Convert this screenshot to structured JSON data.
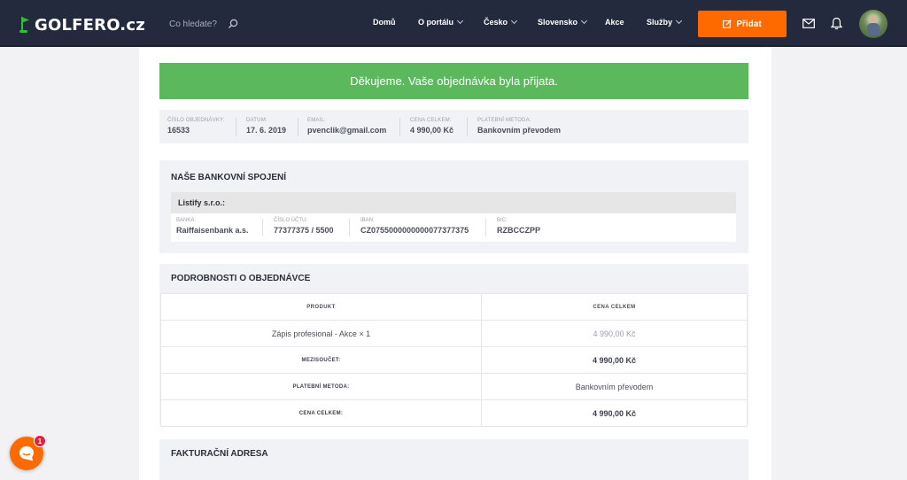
{
  "header": {
    "logo_text": "GOLFERO.cz",
    "search_placeholder": "Co hledate?",
    "nav": [
      {
        "label": "Domů",
        "has_dropdown": false
      },
      {
        "label": "O portálu",
        "has_dropdown": true
      },
      {
        "label": "Česko",
        "has_dropdown": true
      },
      {
        "label": "Slovensko",
        "has_dropdown": true
      },
      {
        "label": "Akce",
        "has_dropdown": false
      },
      {
        "label": "Služby",
        "has_dropdown": true
      }
    ],
    "add_button": "Přidat",
    "colors": {
      "bar": "#242a3d",
      "accent": "#ff6a00",
      "logo_green": "#2fbf3a"
    }
  },
  "alert": {
    "text": "Děkujeme. Vaše objednávka byla přijata.",
    "color": "#5cb85c"
  },
  "order": {
    "fields": [
      {
        "label": "ČÍSLO OBJEDNÁVKY:",
        "value": "16533"
      },
      {
        "label": "DATUM:",
        "value": "17. 6. 2019"
      },
      {
        "label": "EMAIL:",
        "value": "pvenclik@gmail.com"
      },
      {
        "label": "CENA CELKEM:",
        "value": "4 990,00 Kč"
      },
      {
        "label": "PLATEBNÍ METODA:",
        "value": "Bankovním převodem"
      }
    ]
  },
  "bank": {
    "title": "NAŠE BANKOVNÍ SPOJENÍ",
    "account_name": "Listify s.r.o.:",
    "fields": [
      {
        "label": "BANKA:",
        "value": "Raiffaisenbank a.s."
      },
      {
        "label": "ČÍSLO ÚČTU:",
        "value": "77377375 / 5500"
      },
      {
        "label": "IBAN:",
        "value": "CZ0755000000000077377375"
      },
      {
        "label": "BIC:",
        "value": "RZBCCZPP"
      }
    ]
  },
  "details": {
    "title": "PODROBNOSTI O OBJEDNÁVCE",
    "headers": [
      "PRODUKT",
      "CENA CELKEM"
    ],
    "product": {
      "name": "Zápis profesional - Akce × 1",
      "price": "4 990,00 Kč"
    },
    "subtotal": {
      "label": "MEZISOUČET:",
      "value": "4 990,00 Kč"
    },
    "payment": {
      "label": "PLATEBNÍ METODA:",
      "value": "Bankovním převodem"
    },
    "total": {
      "label": "CENA CELKEM:",
      "value": "4 990,00 Kč"
    }
  },
  "billing": {
    "title": "FAKTURAČNÍ ADRESA"
  },
  "chat": {
    "badge_count": "1"
  }
}
